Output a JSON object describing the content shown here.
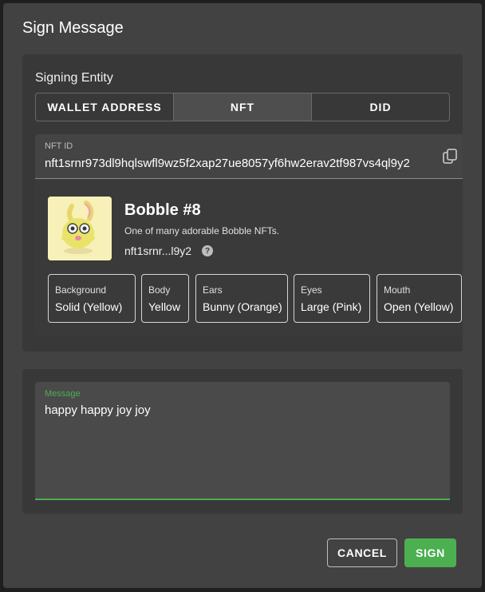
{
  "dialog": {
    "title": "Sign Message"
  },
  "signing_entity": {
    "label": "Signing Entity",
    "options": [
      "WALLET ADDRESS",
      "NFT",
      "DID"
    ],
    "selected": "NFT"
  },
  "nft_field": {
    "label": "NFT ID",
    "value": "nft1srnr973dl9hqlswfl9wz5f2xap27ue8057yf6hw2erav2tf987vs4ql9y2",
    "copy_icon": "copy-icon"
  },
  "nft": {
    "name": "Bobble #8",
    "description": "One of many adorable Bobble NFTs.",
    "short_id": "nft1srnr...l9y2",
    "help_icon": "help-icon",
    "help_glyph": "?",
    "attributes": [
      {
        "key": "Background",
        "value": "Solid (Yellow)"
      },
      {
        "key": "Body",
        "value": "Yellow"
      },
      {
        "key": "Ears",
        "value": "Bunny (Orange)"
      },
      {
        "key": "Eyes",
        "value": "Large (Pink)"
      },
      {
        "key": "Mouth",
        "value": "Open (Yellow)"
      }
    ]
  },
  "message_field": {
    "label": "Message",
    "value": "happy happy joy joy"
  },
  "actions": {
    "cancel_label": "CANCEL",
    "sign_label": "SIGN"
  },
  "colors": {
    "accent": "#4caf50",
    "dialog_bg": "#424242",
    "card_bg": "#383838",
    "nft_thumb_bg": "#f7f0b8"
  }
}
